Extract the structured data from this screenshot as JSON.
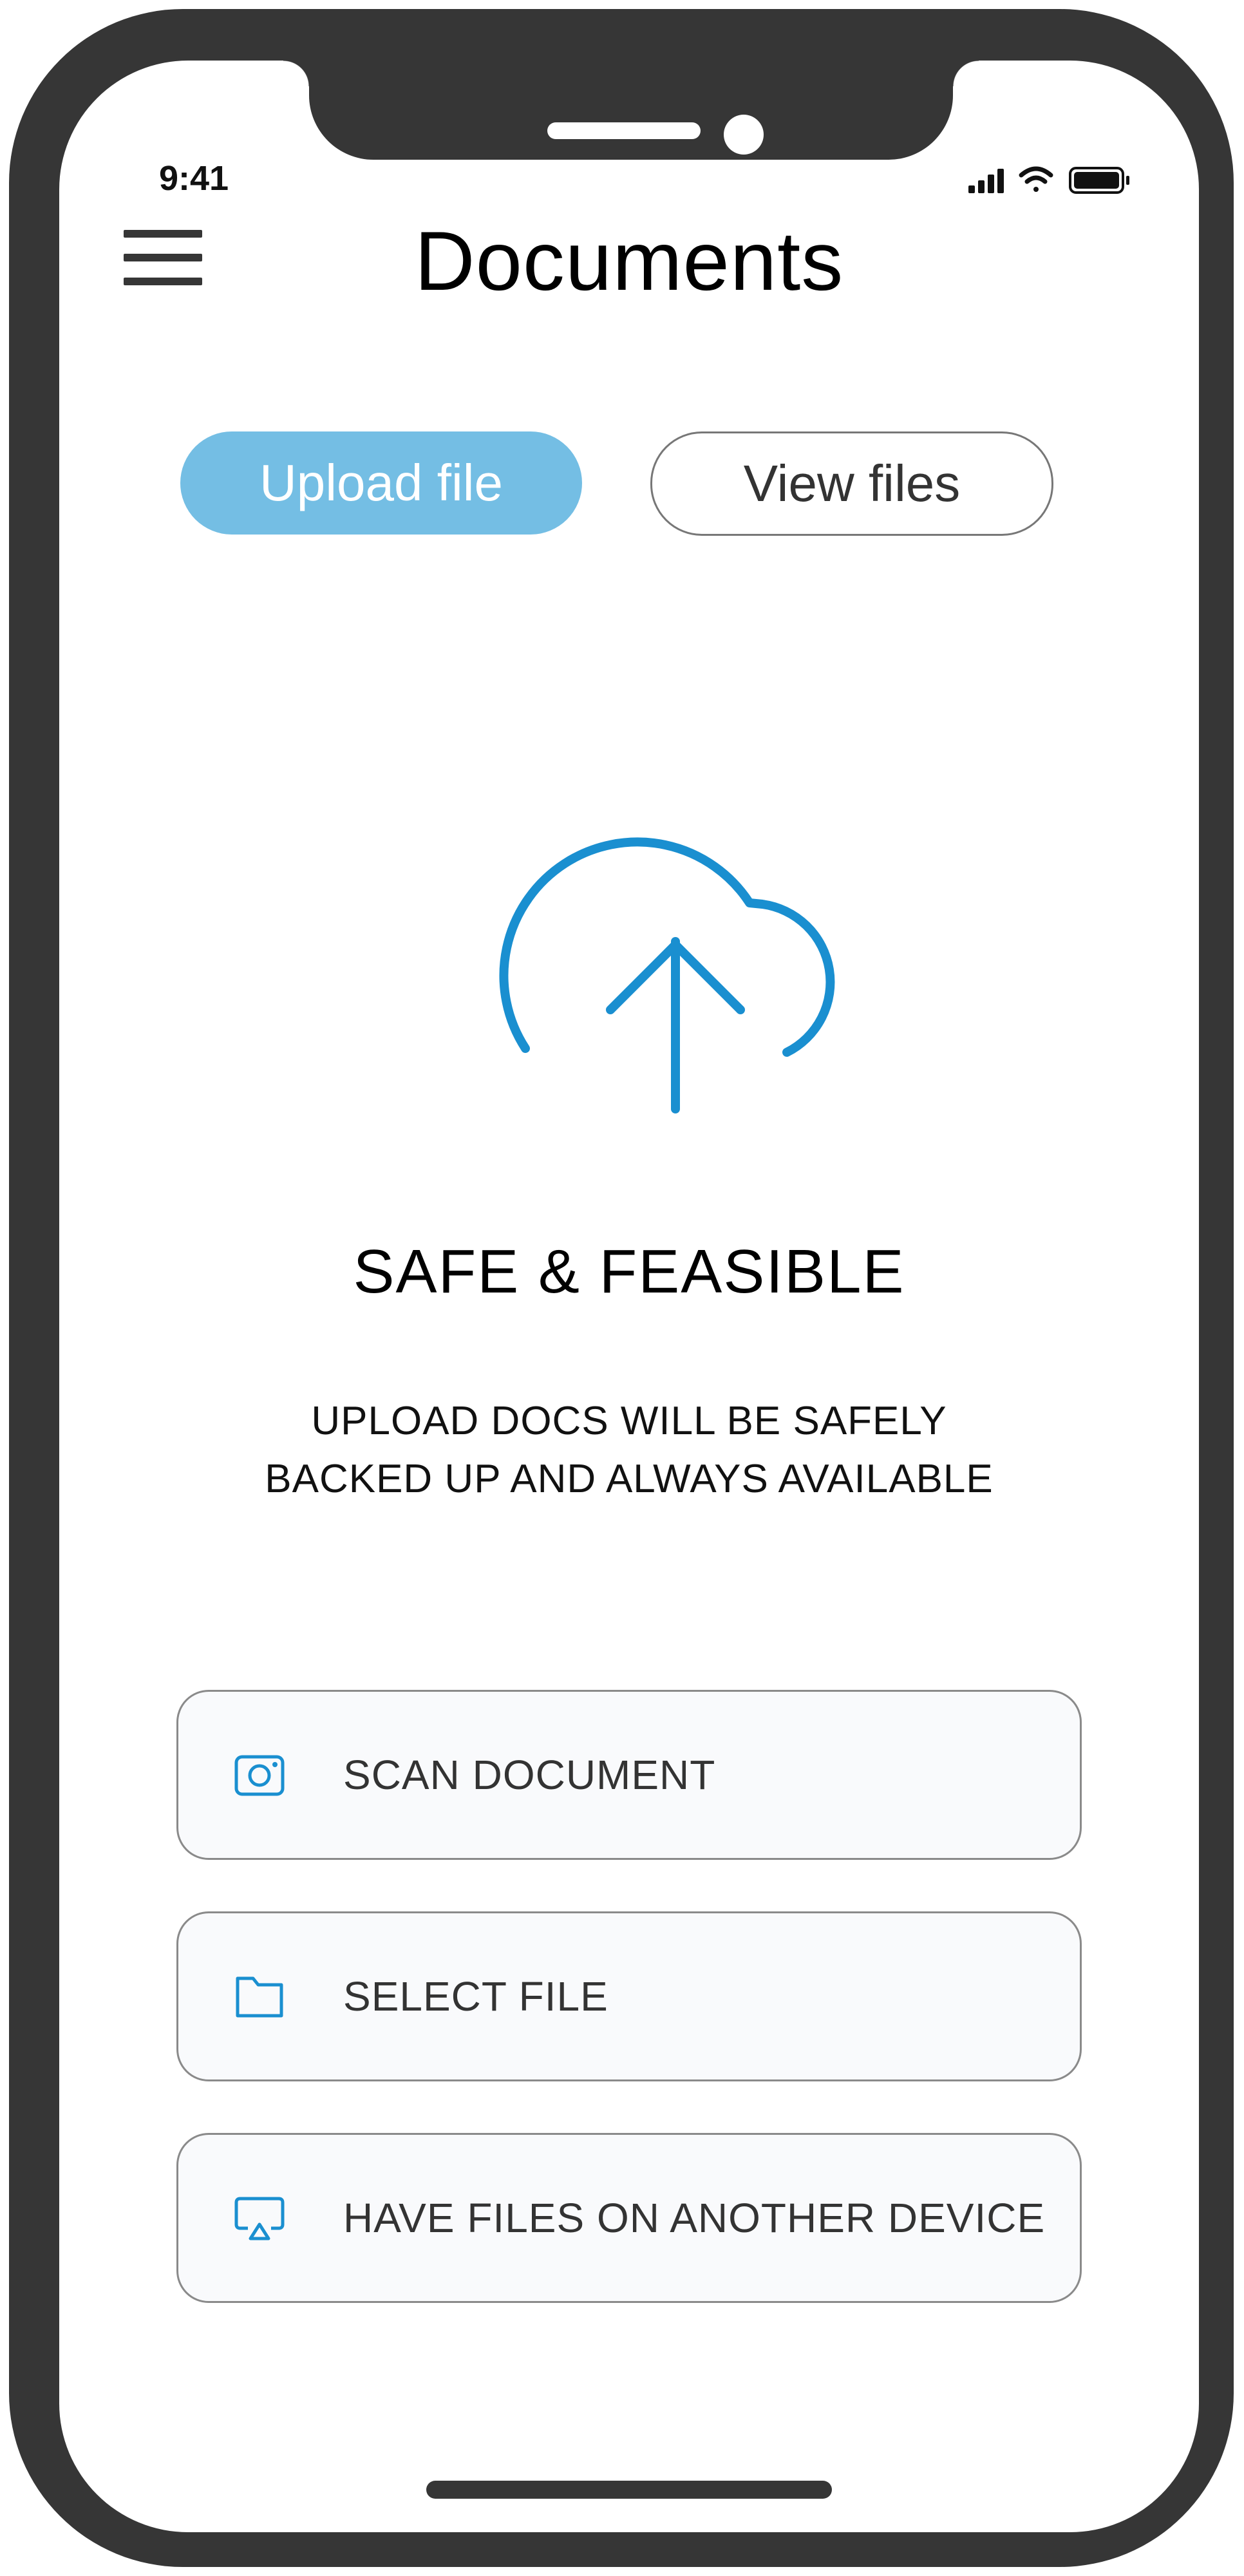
{
  "status_bar": {
    "time": "9:41",
    "icons": [
      "signal-icon",
      "wifi-icon",
      "battery-icon"
    ]
  },
  "header": {
    "title": "Documents",
    "menu_icon": "hamburger-menu-icon"
  },
  "tabs": [
    {
      "label": "Upload file",
      "active": true
    },
    {
      "label": "View files",
      "active": false
    }
  ],
  "hero": {
    "icon": "cloud-upload-icon",
    "headline": "SAFE & FEASIBLE",
    "description_lines": [
      "UPLOAD DOCS WILL BE SAFELY",
      "BACKED UP AND ALWAYS AVAILABLE"
    ]
  },
  "options": [
    {
      "label": "SCAN DOCUMENT",
      "icon": "camera-icon"
    },
    {
      "label": "SELECT FILE",
      "icon": "folder-icon"
    },
    {
      "label": "HAVE FILES ON ANOTHER DEVICE",
      "icon": "airplay-icon"
    }
  ],
  "colors": {
    "accent": "#1a8fd0",
    "active_tab": "#74bee4",
    "frame": "#363636",
    "card_background": "#f9fafc"
  }
}
